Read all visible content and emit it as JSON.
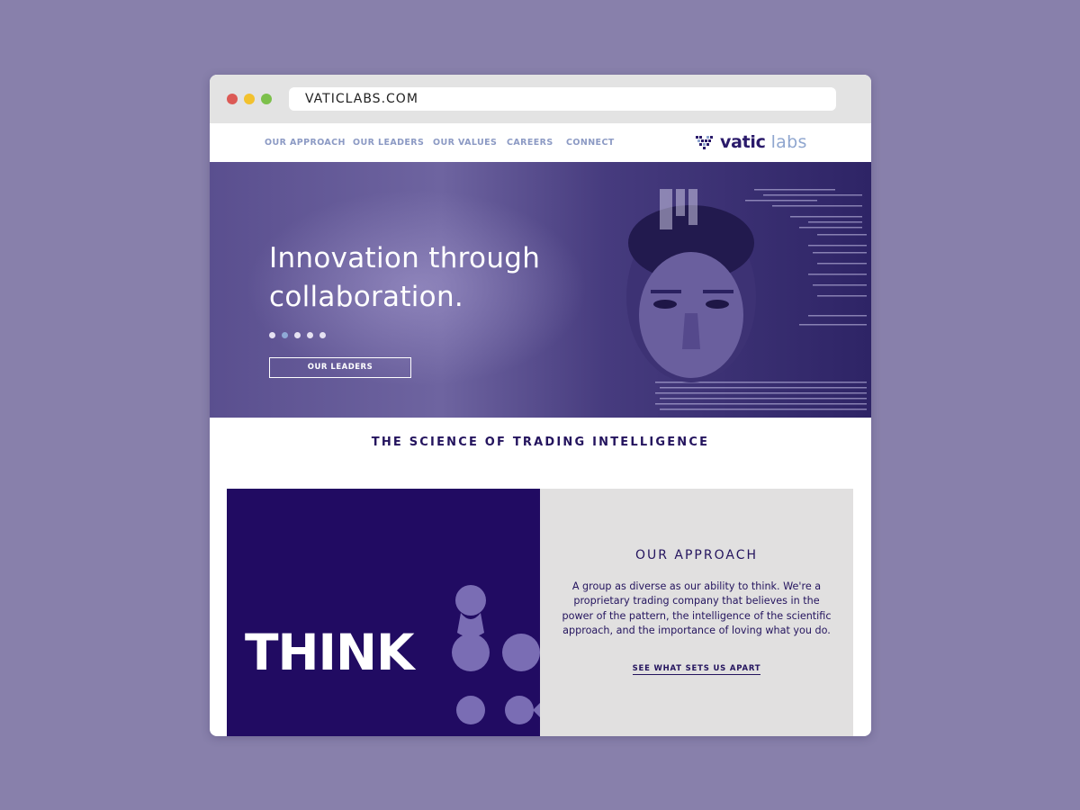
{
  "browser": {
    "url": "VATICLABS.COM"
  },
  "nav": {
    "items": [
      {
        "label": "OUR APPROACH"
      },
      {
        "label": "OUR LEADERS"
      },
      {
        "label": "OUR VALUES"
      },
      {
        "label": "CAREERS"
      },
      {
        "label": "CONNECT"
      }
    ],
    "logo": {
      "word1": "vatic",
      "word2": "labs",
      "icon": "vatic-labs-pixel-heart-icon"
    }
  },
  "hero": {
    "title": "Innovation through collaboration.",
    "carousel_count": 5,
    "carousel_active_index": 1,
    "button_label": "OUR LEADERS"
  },
  "tagline": "THE SCIENCE OF TRADING INTELLIGENCE",
  "think_panel": {
    "word": "THINK"
  },
  "approach": {
    "title": "OUR APPROACH",
    "body": "A group as diverse as our ability to think. We're a proprietary trading company that believes in the power of the pattern, the intelligence of the scientific approach, and the importance of loving what you do.",
    "link_label": "SEE WHAT SETS US APART"
  },
  "colors": {
    "background": "#8880ab",
    "brand_navy": "#210b62",
    "nav_text": "#8c9ac4",
    "panel_grey": "#e1e0e0"
  }
}
